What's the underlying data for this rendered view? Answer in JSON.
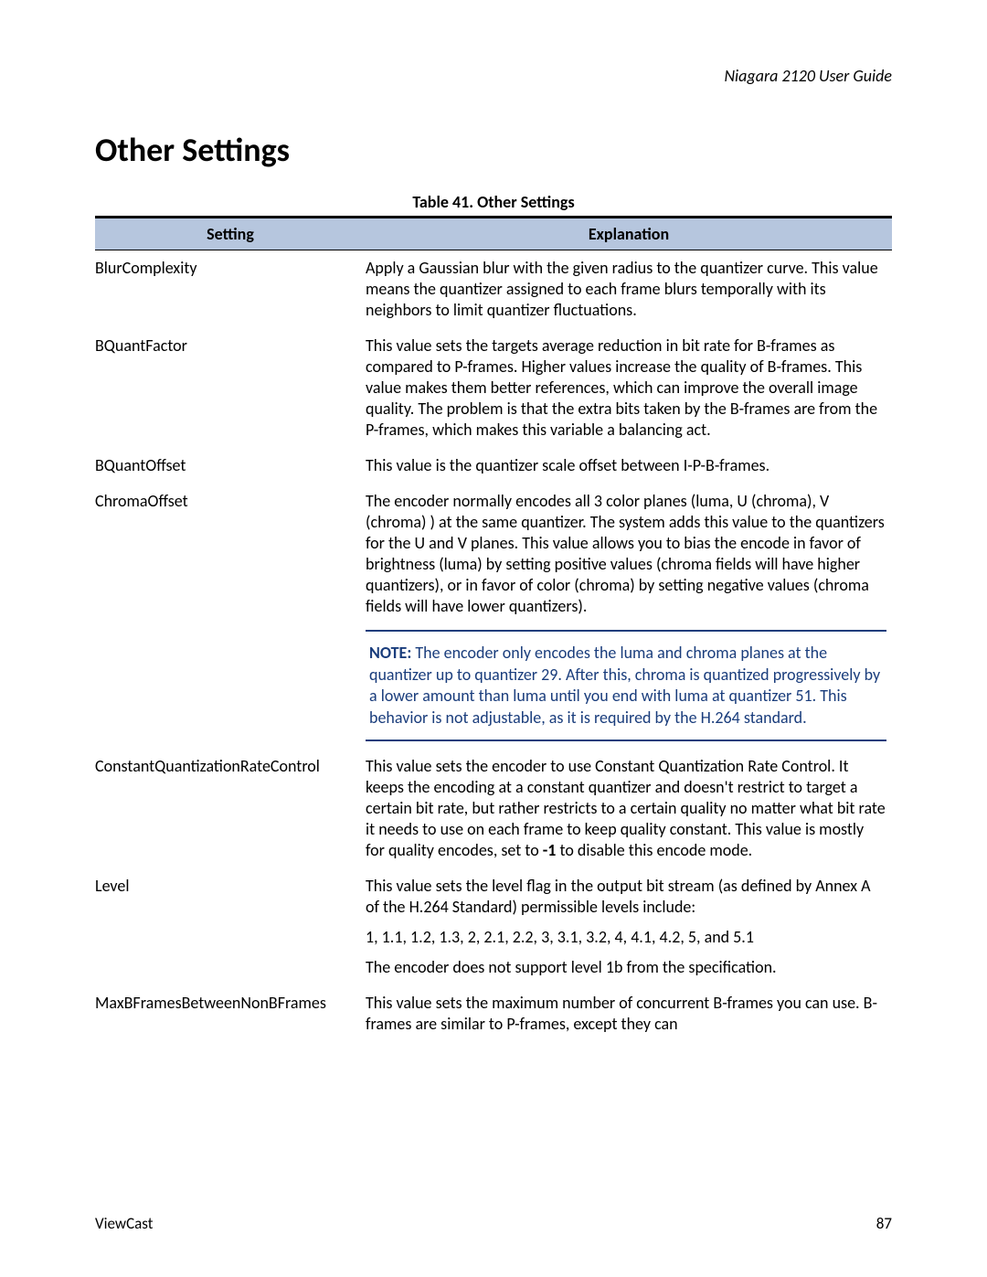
{
  "doc": {
    "running_head": "Niagara 2120 User Guide",
    "heading": "Other Settings",
    "table_caption": "Table 41. Other Settings",
    "col_setting": "Setting",
    "col_explanation": "Explanation",
    "footer_left": "ViewCast",
    "footer_right": "87"
  },
  "rows": {
    "blur_complexity": {
      "name": "BlurComplexity",
      "text": "Apply a Gaussian blur with the given radius to the quantizer curve. This value means the quantizer assigned to each frame blurs temporally with its neighbors to limit quantizer fluctuations."
    },
    "bquant_factor": {
      "name": "BQuantFactor",
      "text": "This value sets the targets average reduction in bit rate for B-frames as compared to P-frames. Higher values increase the quality of B-frames. This value makes them better references, which can improve the overall image quality. The problem is that the extra bits taken by the B-frames are from the P-frames, which makes this variable a balancing act."
    },
    "bquant_offset": {
      "name": "BQuantOffset",
      "text": "This value is the quantizer scale offset between I-P-B-frames."
    },
    "chroma_offset": {
      "name": "ChromaOffset",
      "text": "The encoder normally encodes all 3 color planes (luma, U (chroma), V (chroma) ) at the same quantizer. The system adds this value to the quantizers for the U and V planes. This value allows you to bias the encode in favor of brightness (luma) by setting positive values (chroma fields will have higher quantizers), or in favor of color (chroma) by setting negative values (chroma fields will have lower quantizers).",
      "note_label": "NOTE:",
      "note_text": "  The encoder only encodes the luma and chroma planes at the quantizer up to quantizer 29. After this, chroma is quantized progressively by a lower amount than luma until you end with luma at quantizer 51. This behavior is not adjustable, as it is required by the H.264 standard."
    },
    "cq_rate_control": {
      "name": "ConstantQuantizationRateControl",
      "text_pre": "This value sets the encoder to use Constant Quantization Rate Control. It keeps the encoding at a constant quantizer and doesn't restrict to target a certain bit rate, but rather restricts to a certain quality no matter what bit rate it needs to use on each frame to keep quality constant. This value is mostly for quality encodes, set to ",
      "bold": "-1",
      "text_post": " to disable this encode mode."
    },
    "level": {
      "name": "Level",
      "text": "This value sets the level flag in the output bit stream (as defined by Annex A of the H.264 Standard) permissible levels include:",
      "levels": "1, 1.1, 1.2, 1.3, 2, 2.1, 2.2, 3, 3.1, 3.2, 4, 4.1, 4.2, 5, and 5.1",
      "unsupported": "The encoder does not support level 1b from the specification."
    },
    "max_bframes": {
      "name": "MaxBFramesBetweenNonBFrames",
      "text": "This value sets the maximum number of concurrent B-frames you can use. B-frames are similar to P-frames, except they can"
    }
  }
}
